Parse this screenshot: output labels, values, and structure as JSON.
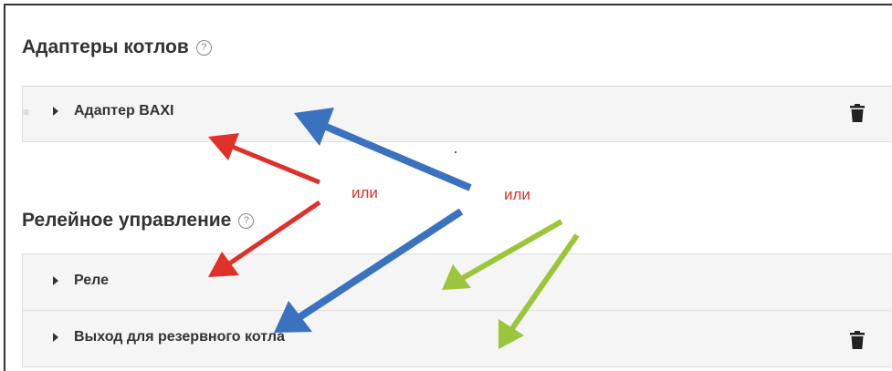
{
  "sections": [
    {
      "title": "Адаптеры котлов",
      "help": "?",
      "items": [
        {
          "label": "Адаптер BAXI",
          "drag_handle": "≡",
          "has_delete": true
        }
      ]
    },
    {
      "title": "Релейное управление",
      "help": "?",
      "items": [
        {
          "label": "Реле",
          "has_delete": false
        },
        {
          "label": "Выход для резервного котла",
          "has_delete": true
        }
      ]
    }
  ],
  "annotations": {
    "or_left": "или",
    "or_right": "или",
    "colors": {
      "red": "#e0302a",
      "blue": "#3a72bf",
      "green": "#9bc63b",
      "text": "#e0302a"
    }
  },
  "icons": {
    "help": "help-circle-icon",
    "expand": "caret-right-icon",
    "delete": "trash-icon",
    "drag": "drag-handle-icon"
  }
}
